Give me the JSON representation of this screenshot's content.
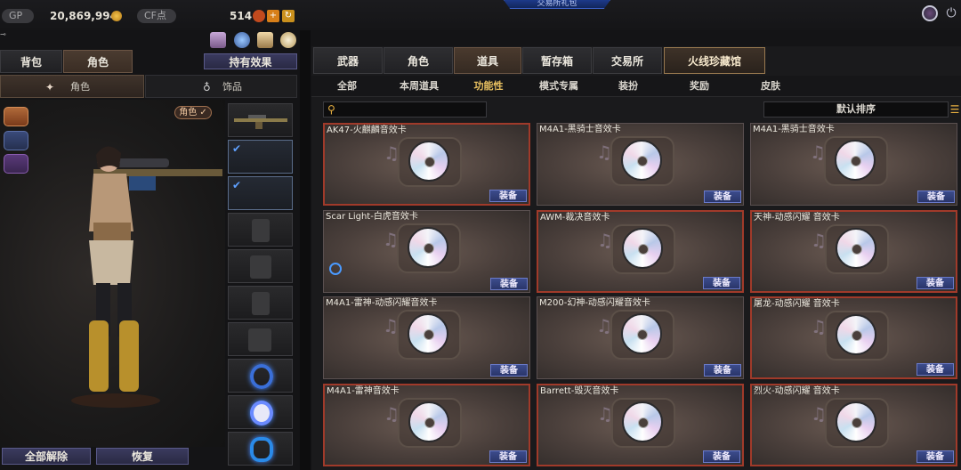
{
  "topbar": {
    "gp_label": "GP",
    "gp_value": "20,869,994",
    "cf_label": "CF点",
    "cf_value": "514",
    "trade_gift": "交易所礼包",
    "add_icon": "+",
    "refresh_icon": "↻"
  },
  "left": {
    "tabs": [
      "背包",
      "角色"
    ],
    "effects_tab": "持有效果",
    "subtabs": [
      "角色",
      "饰品"
    ],
    "role_badge": "角色 ✓",
    "btn_remove_all": "全部解除",
    "btn_restore": "恢复"
  },
  "right": {
    "main_tabs": [
      "武器",
      "角色",
      "道具",
      "暂存箱",
      "交易所",
      "火线珍藏馆"
    ],
    "active_main_tab": "道具",
    "cat_tabs": [
      "全部",
      "本周道具",
      "功能性",
      "模式专属",
      "装扮",
      "奖励",
      "皮肤"
    ],
    "active_cat_tab": "功能性",
    "sort_label": "默认排序",
    "equip_label": "装备",
    "items": [
      {
        "title": "AK47-火麒麟音效卡",
        "highlight": true
      },
      {
        "title": "M4A1-黑骑士音效卡",
        "highlight": false
      },
      {
        "title": "M4A1-黑骑士音效卡",
        "highlight": false
      },
      {
        "title": "Scar Light-白虎音效卡",
        "highlight": false
      },
      {
        "title": "AWM-裁决音效卡",
        "highlight": true
      },
      {
        "title": "天神-动感闪耀 音效卡",
        "highlight": true
      },
      {
        "title": "M4A1-雷神-动感闪耀音效卡",
        "highlight": false
      },
      {
        "title": "M200-幻神-动感闪耀音效卡",
        "highlight": false
      },
      {
        "title": "屠龙-动感闪耀 音效卡",
        "highlight": true
      },
      {
        "title": "M4A1-雷神音效卡",
        "highlight": true
      },
      {
        "title": "Barrett-毁灭音效卡",
        "highlight": true
      },
      {
        "title": "烈火-动感闪耀 音效卡",
        "highlight": true
      }
    ]
  },
  "colors": {
    "accent_gold": "#e8c060",
    "equip_blue": "#3c4c8c",
    "highlight_red": "#a03a2a"
  }
}
